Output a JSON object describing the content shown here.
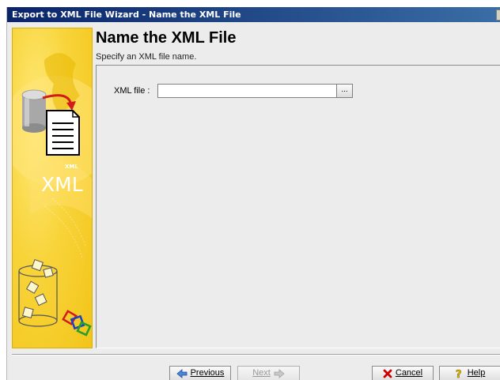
{
  "window": {
    "title": "Export to XML File Wizard - Name the XML File"
  },
  "sidebar": {
    "badge_text": "XML",
    "logo_text": "XML",
    "icons": [
      "database-icon",
      "document-icon",
      "xml-logo",
      "cylinder-cubes-icon",
      "linked-squares-icon"
    ]
  },
  "header": {
    "title": "Name the XML File",
    "subtitle": "Specify an XML file name."
  },
  "form": {
    "xml_file_label": "XML file :",
    "xml_file_value": "",
    "browse_label": "..."
  },
  "footer": {
    "previous_label": "Previous",
    "next_label": "Next",
    "cancel_label": "Cancel",
    "help_label": "Help",
    "next_enabled": false
  },
  "colors": {
    "titlebar_start": "#0a246a",
    "titlebar_end": "#3a6ea5",
    "sidebar_yellow": "#f8d43a",
    "window_bg": "#ececec",
    "cancel_icon": "#cc0000",
    "help_icon": "#e6c000",
    "nav_arrow": "#2a5db0"
  }
}
